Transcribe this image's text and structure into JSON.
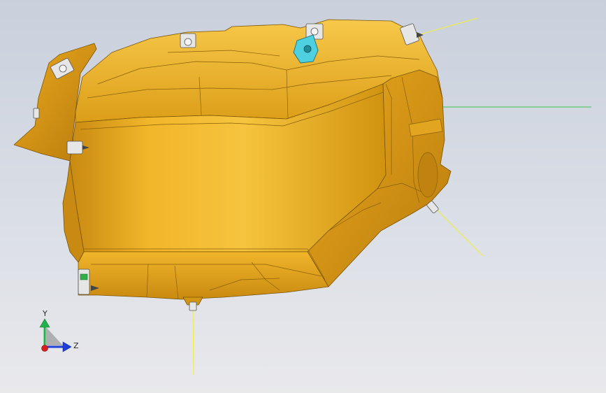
{
  "viewport": {
    "background_top": "#c9d0dc",
    "background_bottom": "#e9e9ec",
    "model_color": "#e8a41a",
    "model_highlight": "#f7c545",
    "model_shadow": "#b97d10",
    "edge_color": "#7a5405",
    "selected_part_color": "#4fd0e0",
    "fastener_color": "#d9d9d9",
    "green_marker_color": "#32b04a",
    "guide_line_color": "#f2ee3a",
    "green_guide_color": "#39c14a"
  },
  "triad": {
    "x_label": "",
    "y_label": "Y",
    "z_label": "Z",
    "y_color": "#22b14c",
    "z_color": "#1f3fd6",
    "x_color": "#d81e1e"
  }
}
